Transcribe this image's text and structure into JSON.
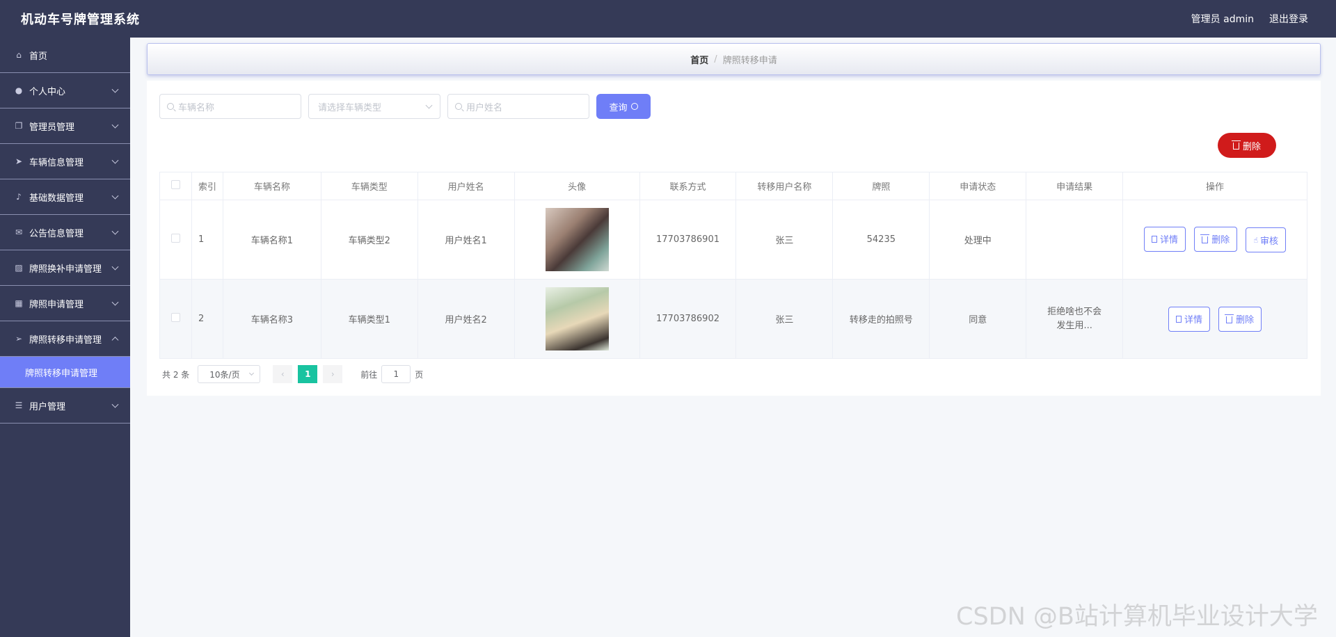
{
  "header": {
    "title": "机动车号牌管理系统",
    "admin_label": "管理员 admin",
    "logout_label": "退出登录"
  },
  "sidebar": {
    "items": [
      {
        "label": "首页",
        "icon": "home-icon",
        "has_arrow": false
      },
      {
        "label": "个人中心",
        "icon": "user-icon",
        "has_arrow": true
      },
      {
        "label": "管理员管理",
        "icon": "copy-icon",
        "has_arrow": true
      },
      {
        "label": "车辆信息管理",
        "icon": "send-icon",
        "has_arrow": true
      },
      {
        "label": "基础数据管理",
        "icon": "microphone-icon",
        "has_arrow": true
      },
      {
        "label": "公告信息管理",
        "icon": "message-icon",
        "has_arrow": true
      },
      {
        "label": "牌照换补申请管理",
        "icon": "chart-icon",
        "has_arrow": true
      },
      {
        "label": "牌照申请管理",
        "icon": "grid-icon",
        "has_arrow": true
      },
      {
        "label": "牌照转移申请管理",
        "icon": "position-icon",
        "has_arrow": true,
        "expanded": true
      },
      {
        "label": "用户管理",
        "icon": "list-icon",
        "has_arrow": true
      }
    ],
    "submenu_active": "牌照转移申请管理"
  },
  "breadcrumb": {
    "home": "首页",
    "separator": "/",
    "current": "牌照转移申请"
  },
  "search": {
    "vehicle_name_placeholder": "车辆名称",
    "vehicle_type_placeholder": "请选择车辆类型",
    "user_name_placeholder": "用户姓名",
    "query_label": "查询"
  },
  "toolbar": {
    "delete_label": "删除"
  },
  "table": {
    "headers": [
      "索引",
      "车辆名称",
      "车辆类型",
      "用户姓名",
      "头像",
      "联系方式",
      "转移用户名称",
      "牌照",
      "申请状态",
      "申请结果",
      "操作"
    ],
    "rows": [
      {
        "index": "1",
        "vehicle_name": "车辆名称1",
        "vehicle_type": "车辆类型2",
        "user_name": "用户姓名1",
        "phone": "17703786901",
        "transfer_user": "张三",
        "plate": "54235",
        "status": "处理中",
        "result": "",
        "actions": [
          "详情",
          "删除",
          "审核"
        ]
      },
      {
        "index": "2",
        "vehicle_name": "车辆名称3",
        "vehicle_type": "车辆类型1",
        "user_name": "用户姓名2",
        "phone": "17703786902",
        "transfer_user": "张三",
        "plate": "转移走的拍照号",
        "status": "同意",
        "result": "拒绝啥也不会发生用...",
        "actions": [
          "详情",
          "删除"
        ]
      }
    ]
  },
  "pagination": {
    "total_label": "共 2 条",
    "page_size": "10条/页",
    "current_page": "1",
    "goto_label": "前往",
    "goto_value": "1",
    "page_suffix": "页"
  },
  "watermark": "CSDN @B站计算机毕业设计大学",
  "colors": {
    "sidebar_bg": "#353a57",
    "accent": "#6f7ef7",
    "danger": "#d01b1b",
    "pager_active": "#19c3a0"
  }
}
